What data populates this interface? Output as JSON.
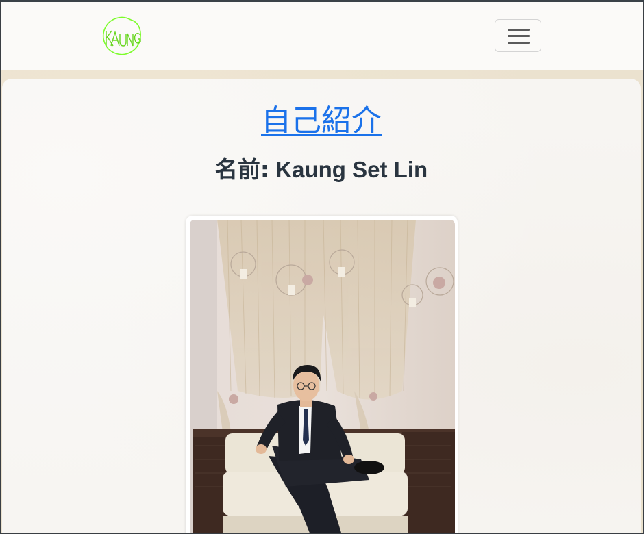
{
  "navbar": {
    "logo_text": "KAUNG",
    "logo_color": "#7cfc2a",
    "menu_icon": "hamburger-icon"
  },
  "main": {
    "title": "自己紹介",
    "name_label": "名前:",
    "name_value": "Kaung Set Lin"
  },
  "colors": {
    "title_link": "#1b72ea",
    "text": "#2a3540",
    "card": "#f7f5f2"
  }
}
